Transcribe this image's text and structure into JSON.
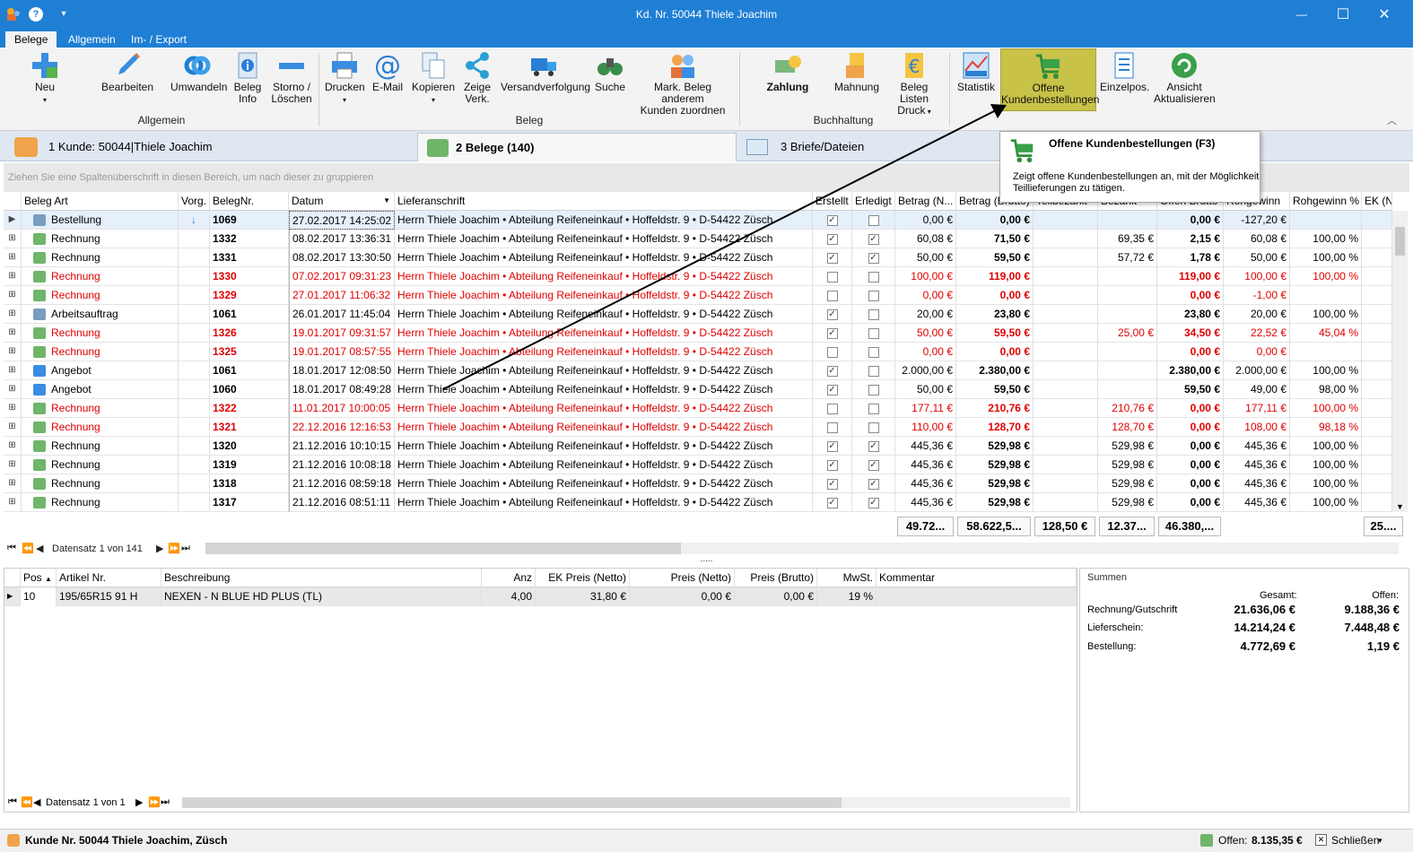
{
  "window": {
    "title": "Kd. Nr. 50044 Thiele Joachim",
    "help": "?",
    "dropdown": "▾",
    "minimize": "—",
    "maximize": "☐",
    "close": "✕"
  },
  "ribbon_tabs": [
    "Belege",
    "Allgemein",
    "Im- / Export"
  ],
  "ribbon": {
    "buttons": {
      "neu": "Neu",
      "bearbeiten": "Bearbeiten",
      "umwandeln": "Umwandeln",
      "beleg_info_1": "Beleg",
      "beleg_info_2": "Info",
      "storno_1": "Storno /",
      "storno_2": "Löschen",
      "drucken": "Drucken",
      "email": "E-Mail",
      "kopieren": "Kopieren",
      "zeige_1": "Zeige",
      "zeige_2": "Verk.",
      "versand": "Versandverfolgung",
      "suche": "Suche",
      "mark_1": "Mark. Beleg  anderem",
      "mark_2": "Kunden zuordnen",
      "zahlung": "Zahlung",
      "mahnung": "Mahnung",
      "listen_1": "Beleg Listen",
      "listen_2": "Druck",
      "statistik": "Statistik",
      "offene_1": "Offene",
      "offene_2": "Kundenbestellungen",
      "einzelpos": "Einzelpos.",
      "ansicht_1": "Ansicht",
      "ansicht_2": "Aktualisieren"
    },
    "groups": {
      "allgemein": "Allgemein",
      "beleg": "Beleg",
      "buchhaltung": "Buchhaltung"
    }
  },
  "doc_tabs": {
    "kunde": "1 Kunde: 50044|Thiele Joachim",
    "belege": "2 Belege (140)",
    "briefe": "3 Briefe/Dateien"
  },
  "tooltip": {
    "title": "Offene Kundenbestellungen (F3)",
    "text1": "Zeigt offene Kundenbestellungen an, mit der Möglichkeit",
    "text2": "Teillieferungen zu tätigen."
  },
  "group_hint": "Ziehen Sie eine Spaltenüberschrift in diesen Bereich, um nach dieser zu gruppieren",
  "columns": [
    "Beleg Art",
    "Vorg.",
    "BelegNr.",
    "Datum",
    "Lieferanschrift",
    "Erstellt",
    "Erledigt",
    "Betrag (N...",
    "Betrag (Brutto)",
    "Teilbezahlt",
    "Bezahlt",
    "Offen Brutto",
    "Rohgewinn",
    "Rohgewinn %",
    "EK (Netto"
  ],
  "address": "Herrn Thiele Joachim • Abteilung Reifeneinkauf • Hoffeldstr. 9 • D-54422 Züsch",
  "rows": [
    {
      "art": "Bestellung",
      "vorg": "↓",
      "nr": "1069",
      "datum": "27.02.2017 14:25:02",
      "erstellt": "✓",
      "erledigt": "",
      "netto": "0,00 €",
      "brutto": "0,00 €",
      "teil": "",
      "bezahlt": "",
      "offen": "0,00 €",
      "roh": "-127,20 €",
      "rohp": "",
      "red": false
    },
    {
      "art": "Rechnung",
      "vorg": "",
      "nr": "1332",
      "datum": "08.02.2017 13:36:31",
      "erstellt": "✓",
      "erledigt": "✓",
      "netto": "60,08 €",
      "brutto": "71,50 €",
      "teil": "",
      "bezahlt": "69,35 €",
      "offen": "2,15 €",
      "roh": "60,08 €",
      "rohp": "100,00 %",
      "red": false
    },
    {
      "art": "Rechnung",
      "vorg": "",
      "nr": "1331",
      "datum": "08.02.2017 13:30:50",
      "erstellt": "✓",
      "erledigt": "✓",
      "netto": "50,00 €",
      "brutto": "59,50 €",
      "teil": "",
      "bezahlt": "57,72 €",
      "offen": "1,78 €",
      "roh": "50,00 €",
      "rohp": "100,00 %",
      "red": false
    },
    {
      "art": "Rechnung",
      "vorg": "",
      "nr": "1330",
      "datum": "07.02.2017 09:31:23",
      "erstellt": "",
      "erledigt": "",
      "netto": "100,00 €",
      "brutto": "119,00 €",
      "teil": "",
      "bezahlt": "",
      "offen": "119,00 €",
      "roh": "100,00 €",
      "rohp": "100,00 %",
      "red": true
    },
    {
      "art": "Rechnung",
      "vorg": "",
      "nr": "1329",
      "datum": "27.01.2017 11:06:32",
      "erstellt": "",
      "erledigt": "",
      "netto": "0,00 €",
      "brutto": "0,00 €",
      "teil": "",
      "bezahlt": "",
      "offen": "0,00 €",
      "roh": "-1,00 €",
      "rohp": "",
      "red": true
    },
    {
      "art": "Arbeitsauftrag",
      "vorg": "",
      "nr": "1061",
      "datum": "26.01.2017 11:45:04",
      "erstellt": "✓",
      "erledigt": "",
      "netto": "20,00 €",
      "brutto": "23,80 €",
      "teil": "",
      "bezahlt": "",
      "offen": "23,80 €",
      "roh": "20,00 €",
      "rohp": "100,00 %",
      "red": false
    },
    {
      "art": "Rechnung",
      "vorg": "",
      "nr": "1326",
      "datum": "19.01.2017 09:31:57",
      "erstellt": "✓",
      "erledigt": "",
      "netto": "50,00 €",
      "brutto": "59,50 €",
      "teil": "",
      "bezahlt": "25,00 €",
      "offen": "34,50 €",
      "roh": "22,52 €",
      "rohp": "45,04 %",
      "red": true
    },
    {
      "art": "Rechnung",
      "vorg": "",
      "nr": "1325",
      "datum": "19.01.2017 08:57:55",
      "erstellt": "",
      "erledigt": "",
      "netto": "0,00 €",
      "brutto": "0,00 €",
      "teil": "",
      "bezahlt": "",
      "offen": "0,00 €",
      "roh": "0,00 €",
      "rohp": "",
      "red": true
    },
    {
      "art": "Angebot",
      "vorg": "",
      "nr": "1061",
      "datum": "18.01.2017 12:08:50",
      "erstellt": "✓",
      "erledigt": "",
      "netto": "2.000,00 €",
      "brutto": "2.380,00 €",
      "teil": "",
      "bezahlt": "",
      "offen": "2.380,00 €",
      "roh": "2.000,00 €",
      "rohp": "100,00 %",
      "red": false
    },
    {
      "art": "Angebot",
      "vorg": "",
      "nr": "1060",
      "datum": "18.01.2017 08:49:28",
      "erstellt": "✓",
      "erledigt": "",
      "netto": "50,00 €",
      "brutto": "59,50 €",
      "teil": "",
      "bezahlt": "",
      "offen": "59,50 €",
      "roh": "49,00 €",
      "rohp": "98,00 %",
      "red": false
    },
    {
      "art": "Rechnung",
      "vorg": "",
      "nr": "1322",
      "datum": "11.01.2017 10:00:05",
      "erstellt": "",
      "erledigt": "",
      "netto": "177,11 €",
      "brutto": "210,76 €",
      "teil": "",
      "bezahlt": "210,76 €",
      "offen": "0,00 €",
      "roh": "177,11 €",
      "rohp": "100,00 %",
      "red": true
    },
    {
      "art": "Rechnung",
      "vorg": "",
      "nr": "1321",
      "datum": "22.12.2016 12:16:53",
      "erstellt": "",
      "erledigt": "",
      "netto": "110,00 €",
      "brutto": "128,70 €",
      "teil": "",
      "bezahlt": "128,70 €",
      "offen": "0,00 €",
      "roh": "108,00 €",
      "rohp": "98,18 %",
      "red": true
    },
    {
      "art": "Rechnung",
      "vorg": "",
      "nr": "1320",
      "datum": "21.12.2016 10:10:15",
      "erstellt": "✓",
      "erledigt": "✓",
      "netto": "445,36 €",
      "brutto": "529,98 €",
      "teil": "",
      "bezahlt": "529,98 €",
      "offen": "0,00 €",
      "roh": "445,36 €",
      "rohp": "100,00 %",
      "red": false
    },
    {
      "art": "Rechnung",
      "vorg": "",
      "nr": "1319",
      "datum": "21.12.2016 10:08:18",
      "erstellt": "✓",
      "erledigt": "✓",
      "netto": "445,36 €",
      "brutto": "529,98 €",
      "teil": "",
      "bezahlt": "529,98 €",
      "offen": "0,00 €",
      "roh": "445,36 €",
      "rohp": "100,00 %",
      "red": false
    },
    {
      "art": "Rechnung",
      "vorg": "",
      "nr": "1318",
      "datum": "21.12.2016 08:59:18",
      "erstellt": "✓",
      "erledigt": "✓",
      "netto": "445,36 €",
      "brutto": "529,98 €",
      "teil": "",
      "bezahlt": "529,98 €",
      "offen": "0,00 €",
      "roh": "445,36 €",
      "rohp": "100,00 %",
      "red": false
    },
    {
      "art": "Rechnung",
      "vorg": "",
      "nr": "1317",
      "datum": "21.12.2016 08:51:11",
      "erstellt": "✓",
      "erledigt": "✓",
      "netto": "445,36 €",
      "brutto": "529,98 €",
      "teil": "",
      "bezahlt": "529,98 €",
      "offen": "0,00 €",
      "roh": "445,36 €",
      "rohp": "100,00 %",
      "red": false
    }
  ],
  "totals": [
    "49.72...",
    "58.622,5...",
    "128,50 €",
    "12.37...",
    "46.380,...",
    "25...."
  ],
  "nav_top": "Datensatz 1 von 141",
  "splitter": ".....",
  "pos_columns": [
    "Pos",
    "Artikel Nr.",
    "Beschreibung",
    "Anz",
    "EK Preis (Netto)",
    "Preis (Netto)",
    "Preis (Brutto)",
    "MwSt.",
    "Kommentar"
  ],
  "pos_rows": [
    {
      "pos": "10",
      "artikel": "195/65R15 91 H",
      "beschreibung": "NEXEN - N BLUE HD PLUS (TL)",
      "anz": "4,00",
      "ek": "31,80 €",
      "netto": "0,00 €",
      "brutto": "0,00 €",
      "mwst": "19 %",
      "kommentar": ""
    }
  ],
  "nav_bottom": "Datensatz 1 von 1",
  "summen": {
    "title": "Summen",
    "gesamt": "Gesamt:",
    "offen": "Offen:",
    "rows": [
      {
        "label": "Rechnung/Gutschrift",
        "gesamt": "21.636,06 €",
        "offen": "9.188,36 €"
      },
      {
        "label": "Lieferschein:",
        "gesamt": "14.214,24 €",
        "offen": "7.448,48 €"
      },
      {
        "label": "Bestellung:",
        "gesamt": "4.772,69 €",
        "offen": "1,19 €"
      }
    ]
  },
  "status": {
    "customer": "Kunde Nr. 50044 Thiele Joachim, Züsch",
    "offen_label": "Offen:",
    "offen_value": "8.135,35 €",
    "close": "Schließen"
  },
  "colors": {
    "titlebar": "#1f7fd4",
    "highlight": "#c9c248",
    "red_row": "#e00000"
  }
}
